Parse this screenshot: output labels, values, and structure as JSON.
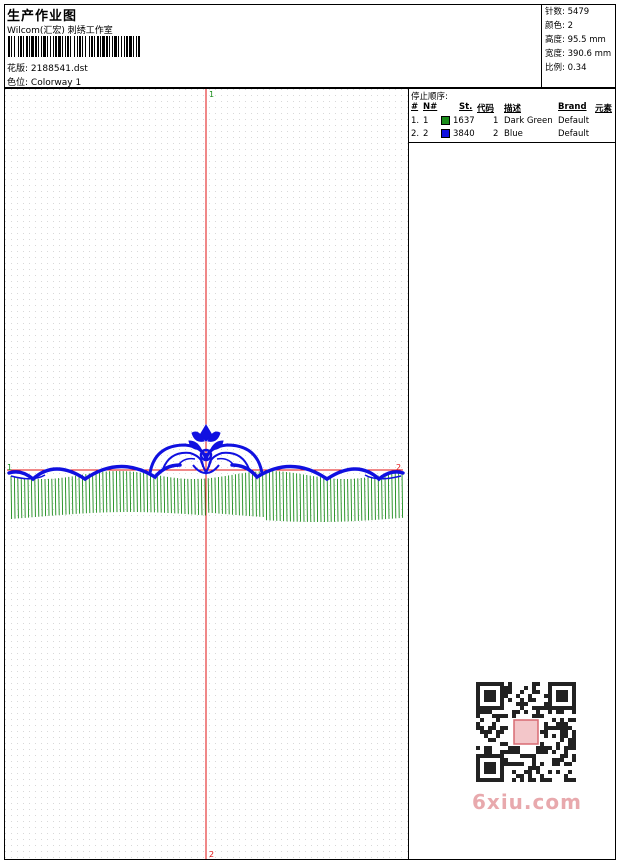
{
  "header": {
    "title": "生产作业图",
    "company": "Wilcom(汇宏) 刺绣工作室",
    "design_label": "花版:",
    "design_value": "2188541.dst",
    "colorway_label": "色位:",
    "colorway_value": "Colorway 1"
  },
  "stats": {
    "stitches": "针数: 5479",
    "colors": "颜色: 2",
    "height": "高度: 95.5 mm",
    "width": "宽度: 390.6 mm",
    "scale": "比例: 0.34"
  },
  "canvas": {
    "marker_top": "1",
    "marker_bottom": "2",
    "marker_left": "1",
    "marker_right": "2"
  },
  "stop_sequence": {
    "title": "停止顺序:",
    "columns": [
      "#",
      "N#",
      "St.",
      "代码",
      "描述",
      "Brand",
      "元素"
    ],
    "rows": [
      {
        "index": "1.",
        "n": "1",
        "color": "#1a8c1a",
        "stitches": "1637",
        "code": "1",
        "description": "Dark Green",
        "brand": "Default"
      },
      {
        "index": "2.",
        "n": "2",
        "color": "#1010e0",
        "stitches": "3840",
        "code": "2",
        "description": "Blue",
        "brand": "Default"
      }
    ]
  },
  "watermark": {
    "text": "6xiu.com"
  },
  "colors": {
    "green_thread": "#1a8c1a",
    "blue_thread": "#1010e0",
    "red_guides": "#e01010"
  }
}
